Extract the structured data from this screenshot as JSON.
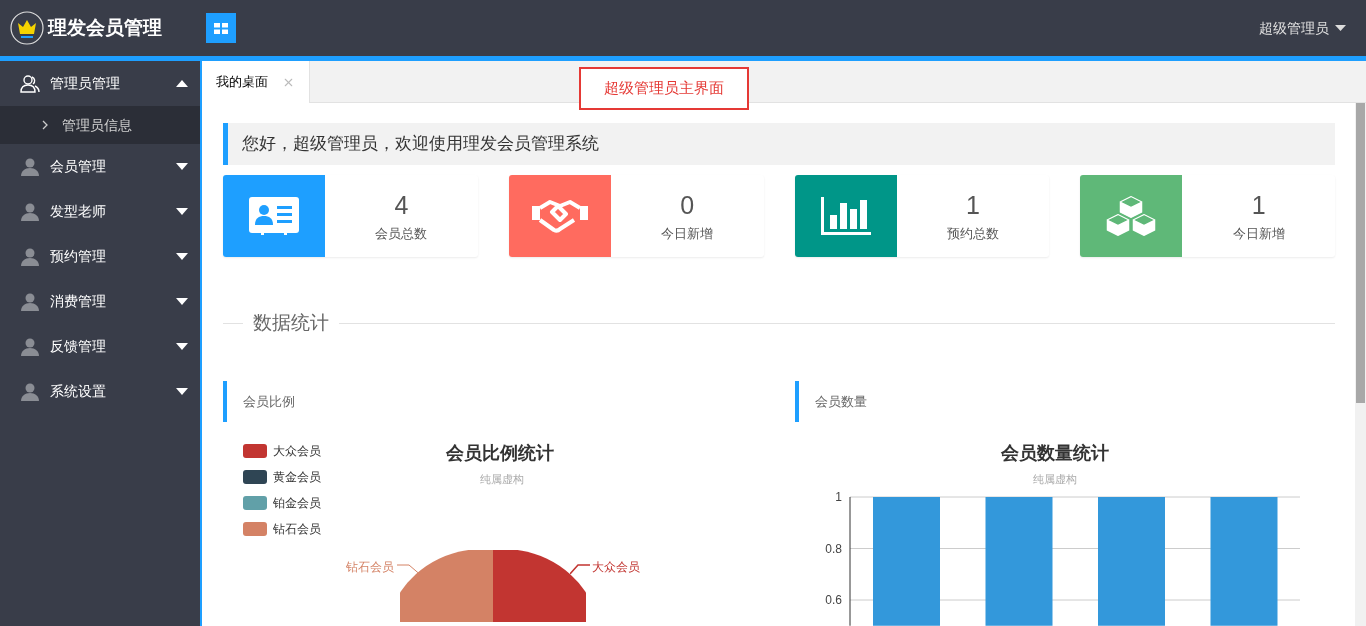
{
  "header": {
    "logo_text": "理发会员管理",
    "user_menu": "超级管理员"
  },
  "sidebar": {
    "items": [
      {
        "label": "管理员管理",
        "expanded": true,
        "children": [
          {
            "label": "管理员信息"
          }
        ]
      },
      {
        "label": "会员管理",
        "expanded": false
      },
      {
        "label": "发型老师",
        "expanded": false
      },
      {
        "label": "预约管理",
        "expanded": false
      },
      {
        "label": "消费管理",
        "expanded": false
      },
      {
        "label": "反馈管理",
        "expanded": false
      },
      {
        "label": "系统设置",
        "expanded": false
      }
    ]
  },
  "tabs": [
    {
      "label": "我的桌面",
      "selected": true
    }
  ],
  "annotation": "超级管理员主界面",
  "welcome": "您好，超级管理员，欢迎使用理发会员管理系统",
  "stats": [
    {
      "kind": "id-card",
      "value": "4",
      "label": "会员总数",
      "color": "#1e9fff"
    },
    {
      "kind": "handshake",
      "value": "0",
      "label": "今日新增",
      "color": "#ff6b5f"
    },
    {
      "kind": "chart",
      "value": "1",
      "label": "预约总数",
      "color": "#009688"
    },
    {
      "kind": "cubes",
      "value": "1",
      "label": "今日新增",
      "color": "#5fb878"
    }
  ],
  "section_title": "数据统计",
  "pie_panel": {
    "title": "会员比例",
    "chart_title": "会员比例统计",
    "subtitle": "纯属虚构",
    "legend": [
      {
        "label": "大众会员",
        "color": "#c23531"
      },
      {
        "label": "黄金会员",
        "color": "#2f4554"
      },
      {
        "label": "铂金会员",
        "color": "#61a0a8"
      },
      {
        "label": "钻石会员",
        "color": "#d48265"
      }
    ],
    "slice_labels": [
      {
        "label": "钻石会员",
        "color": "#d48265"
      },
      {
        "label": "大众会员",
        "color": "#c23531"
      }
    ]
  },
  "bar_panel": {
    "title": "会员数量",
    "chart_title": "会员数量统计",
    "subtitle": "纯属虚构",
    "chart_data": {
      "type": "bar",
      "values": [
        1,
        1,
        1,
        1
      ],
      "ylim": [
        0.5,
        1
      ],
      "yticks": [
        0.6,
        0.8,
        1
      ]
    }
  }
}
